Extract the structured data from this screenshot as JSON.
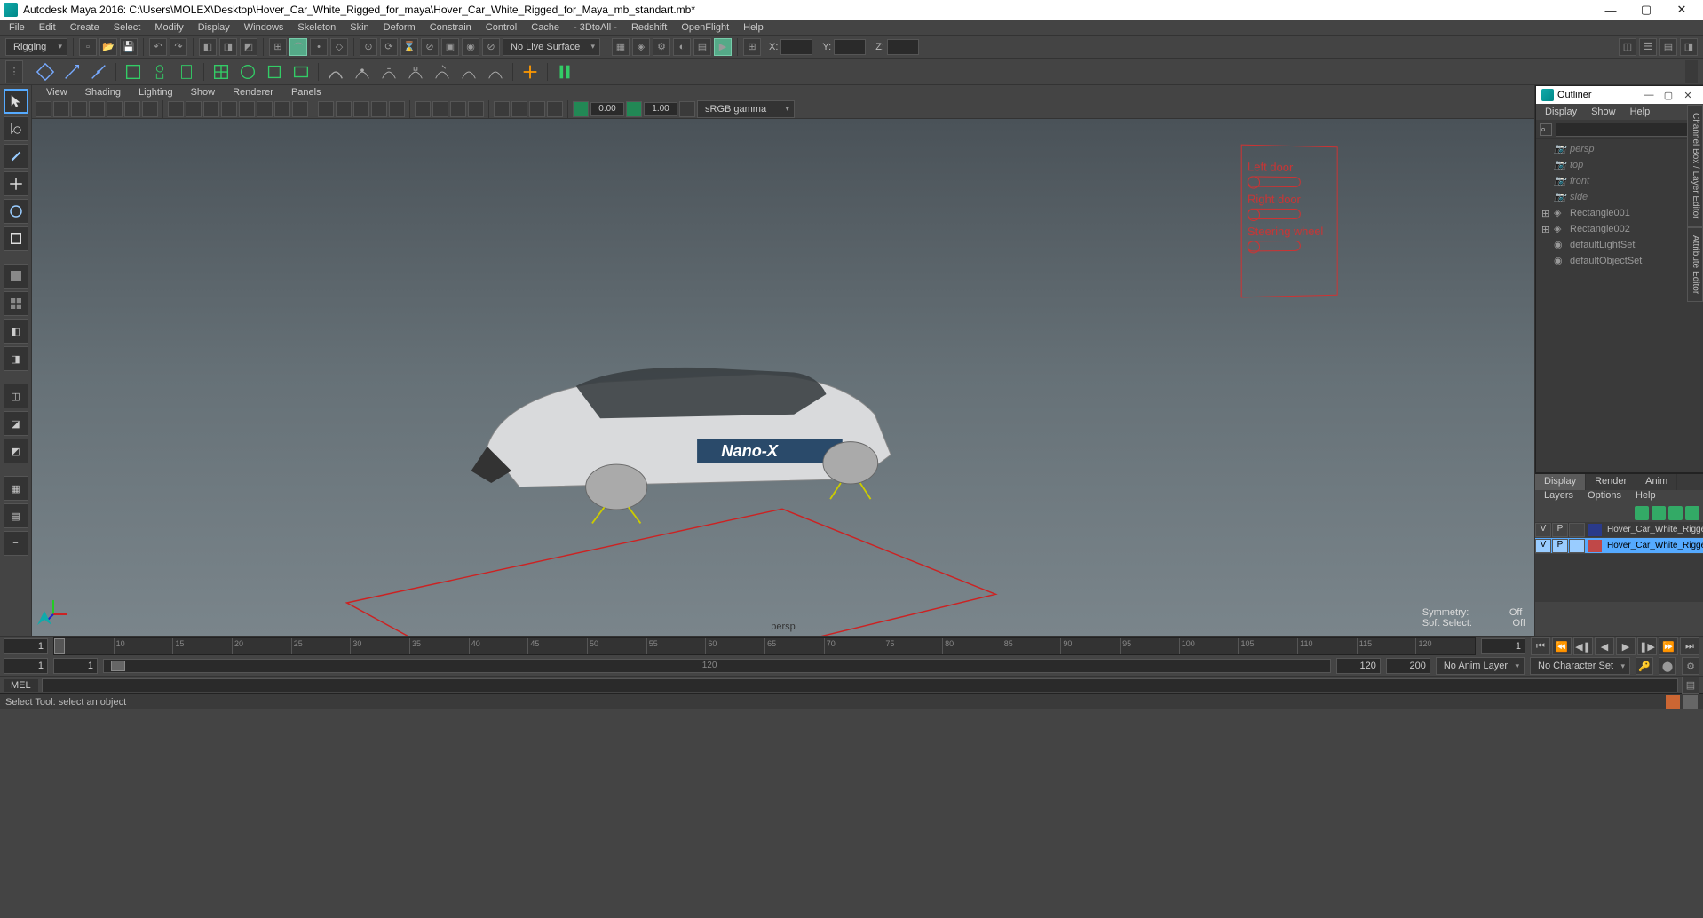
{
  "title": "Autodesk Maya 2016: C:\\Users\\MOLEX\\Desktop\\Hover_Car_White_Rigged_for_maya\\Hover_Car_White_Rigged_for_Maya_mb_standart.mb*",
  "menu": [
    "File",
    "Edit",
    "Create",
    "Select",
    "Modify",
    "Display",
    "Windows",
    "Skeleton",
    "Skin",
    "Deform",
    "Constrain",
    "Control",
    "Cache",
    "- 3DtoAll -",
    "Redshift",
    "OpenFlight",
    "Help"
  ],
  "mode_dropdown": "Rigging",
  "snap_label": "No Live Surface",
  "coord": {
    "x": "X:",
    "y": "Y:",
    "z": "Z:"
  },
  "viewmenu": [
    "View",
    "Shading",
    "Lighting",
    "Show",
    "Renderer",
    "Panels"
  ],
  "exposure": "0.00",
  "gamma": "1.00",
  "colorspace": "sRGB gamma",
  "ctrlpanel": {
    "l1": "Left door",
    "l2": "Right door",
    "l3": "Steering wheel"
  },
  "vp_camera": "persp",
  "vp_status": {
    "sym": "Symmetry:",
    "sym_v": "Off",
    "soft": "Soft Select:",
    "soft_v": "Off"
  },
  "outliner": {
    "title": "Outliner",
    "menu": [
      "Display",
      "Show",
      "Help"
    ],
    "items": [
      {
        "name": "persp",
        "type": "cam",
        "dim": true
      },
      {
        "name": "top",
        "type": "cam",
        "dim": true
      },
      {
        "name": "front",
        "type": "cam",
        "dim": true
      },
      {
        "name": "side",
        "type": "cam",
        "dim": true
      },
      {
        "name": "Rectangle001",
        "type": "shape",
        "exp": true
      },
      {
        "name": "Rectangle002",
        "type": "shape",
        "exp": true
      },
      {
        "name": "defaultLightSet",
        "type": "set"
      },
      {
        "name": "defaultObjectSet",
        "type": "set"
      }
    ]
  },
  "right_tabs": [
    "Channel Box / Layer Editor",
    "Attribute Editor"
  ],
  "dp": {
    "tabs": [
      "Display",
      "Render",
      "Anim"
    ],
    "menu": [
      "Layers",
      "Options",
      "Help"
    ],
    "layers": [
      {
        "v": "V",
        "p": "P",
        "name": "Hover_Car_White_Rigged",
        "color": "#2a3a8a"
      },
      {
        "v": "V",
        "p": "P",
        "name": "Hover_Car_White_Rigged_C",
        "color": "#c04848",
        "selected": true
      }
    ]
  },
  "timeline": {
    "start": "1",
    "cur": "1",
    "ticks": [
      "5",
      "10",
      "15",
      "20",
      "25",
      "30",
      "35",
      "40",
      "45",
      "50",
      "55",
      "60",
      "65",
      "70",
      "75",
      "80",
      "85",
      "90",
      "95",
      "100",
      "105",
      "110",
      "115",
      "120"
    ],
    "range_start": "1",
    "range_inner": "1",
    "range_end_inner": "120",
    "range_end": "120",
    "end_cur": "1",
    "range_sl_in": "120",
    "range_sl_out": "200",
    "anim_layer": "No Anim Layer",
    "char_set": "No Character Set"
  },
  "cmd": {
    "label": "MEL",
    "value": ""
  },
  "status": "Select Tool: select an object",
  "carlabel": "Nano-X"
}
